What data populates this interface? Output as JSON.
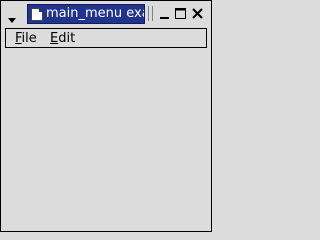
{
  "window": {
    "title": "main_menu exam"
  },
  "titlebar": {
    "icons": [
      "window-menu-icon",
      "app-icon",
      "minimize-icon",
      "maximize-icon",
      "close-icon"
    ]
  },
  "menubar": {
    "items": [
      {
        "mnemonic": "F",
        "rest": "ile"
      },
      {
        "mnemonic": "E",
        "rest": "dit"
      }
    ]
  },
  "colors": {
    "background": "#dcdcdc",
    "title_highlight": "#22338d",
    "title_text": "#ffffff",
    "border": "#000000"
  }
}
